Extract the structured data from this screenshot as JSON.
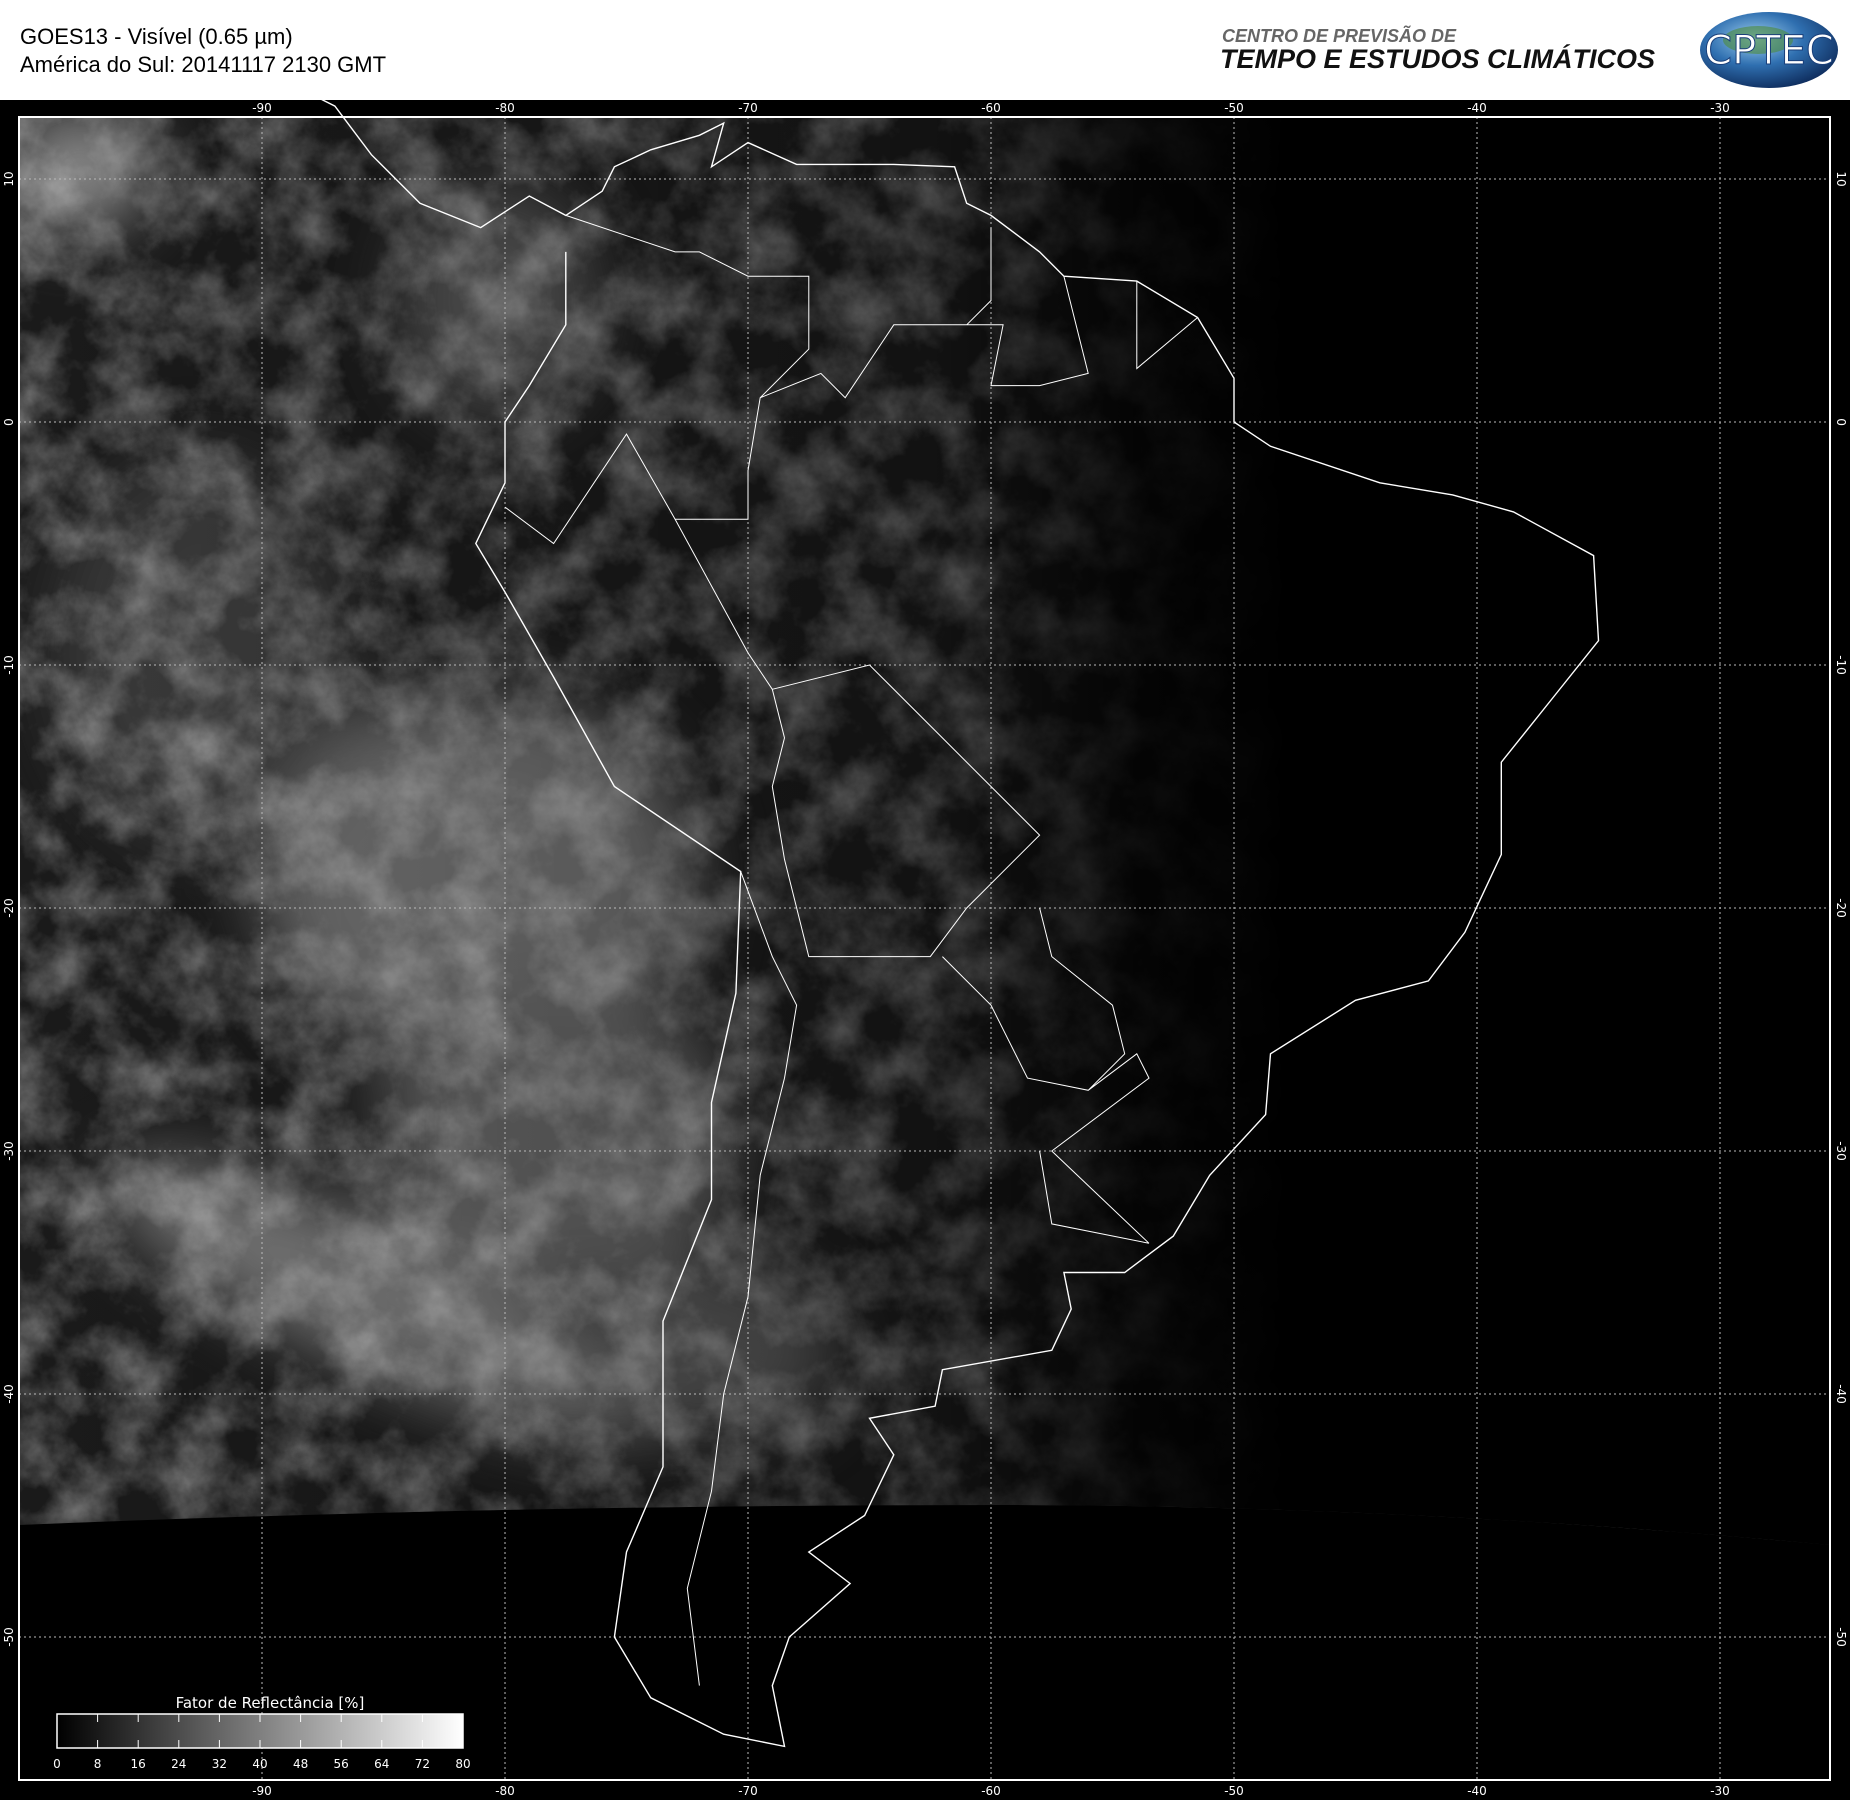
{
  "header": {
    "title_line1": "GOES13 - Visível (0.65 µm)",
    "title_line2": "América do Sul: 20141117 2130 GMT",
    "org_line1": "CENTRO DE PREVISÃO DE",
    "org_line2": "TEMPO E ESTUDOS CLIMÁTICOS",
    "logo_text": "CPTEC"
  },
  "map": {
    "lon_ticks": [
      "-90",
      "-80",
      "-70",
      "-60",
      "-50",
      "-40",
      "-30"
    ],
    "lat_ticks": [
      "10",
      "0",
      "-10",
      "-20",
      "-30",
      "-40",
      "-50"
    ],
    "lon_values": [
      -90,
      -80,
      -70,
      -60,
      -50,
      -40,
      -30
    ],
    "lat_values": [
      10,
      0,
      -10,
      -20,
      -30,
      -40,
      -50
    ]
  },
  "colorbar": {
    "title": "Fator de Reflectância [%]",
    "ticks": [
      "0",
      "8",
      "16",
      "24",
      "32",
      "40",
      "48",
      "56",
      "64",
      "72",
      "80"
    ],
    "min": 0,
    "max": 80
  }
}
